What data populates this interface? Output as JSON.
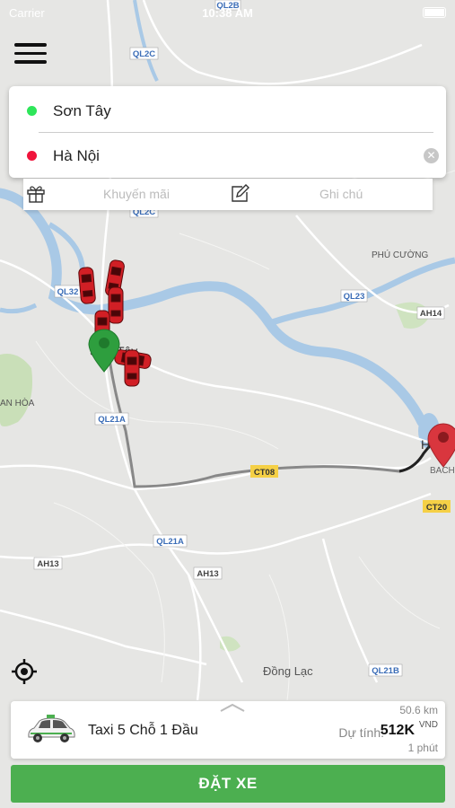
{
  "status_bar": {
    "carrier": "Carrier",
    "time": "10:38 AM"
  },
  "route": {
    "origin": "Sơn Tây",
    "destination": "Hà Nội",
    "origin_color": "#2ee65a",
    "destination_color": "#f0143c"
  },
  "actions": {
    "promo_label": "Khuyến mãi",
    "note_label": "Ghi chú"
  },
  "map_labels": {
    "ql2c_1": "QL2C",
    "ql2c_2": "QL2C",
    "ql2b": "QL2B",
    "ql32": "QL32",
    "ql23": "QL23",
    "ah14": "AH14",
    "ql21a_1": "QL21A",
    "ql21a_2": "QL21A",
    "ct08": "CT08",
    "ct20": "CT20",
    "ah13_1": "AH13",
    "ah13_2": "AH13",
    "ql21b": "QL21B",
    "phu_cuong": "PHÚ CƯỜNG",
    "son_tay": "Sơn Tây",
    "hanoi": "Hà",
    "bach": "BACH",
    "an_hoa": "AN HÒA",
    "dong_lac": "Đồng Lạc"
  },
  "ride": {
    "vehicle": "Taxi 5 Chỗ 1 Đầu",
    "distance": "50.6 km",
    "estimate_label": "Dự tính:",
    "price": "512K",
    "currency": "VND",
    "duration": "1 phút"
  },
  "book_button": "ĐẶT XE",
  "colors": {
    "accent": "#4caf50",
    "marker_origin": "#2e9e3e",
    "marker_dest": "#d9363e",
    "car": "#d11f25"
  },
  "icons": {
    "menu": "menu-icon",
    "gift": "gift-icon",
    "edit": "edit-icon",
    "locate": "locate-icon",
    "clear": "clear-icon"
  }
}
